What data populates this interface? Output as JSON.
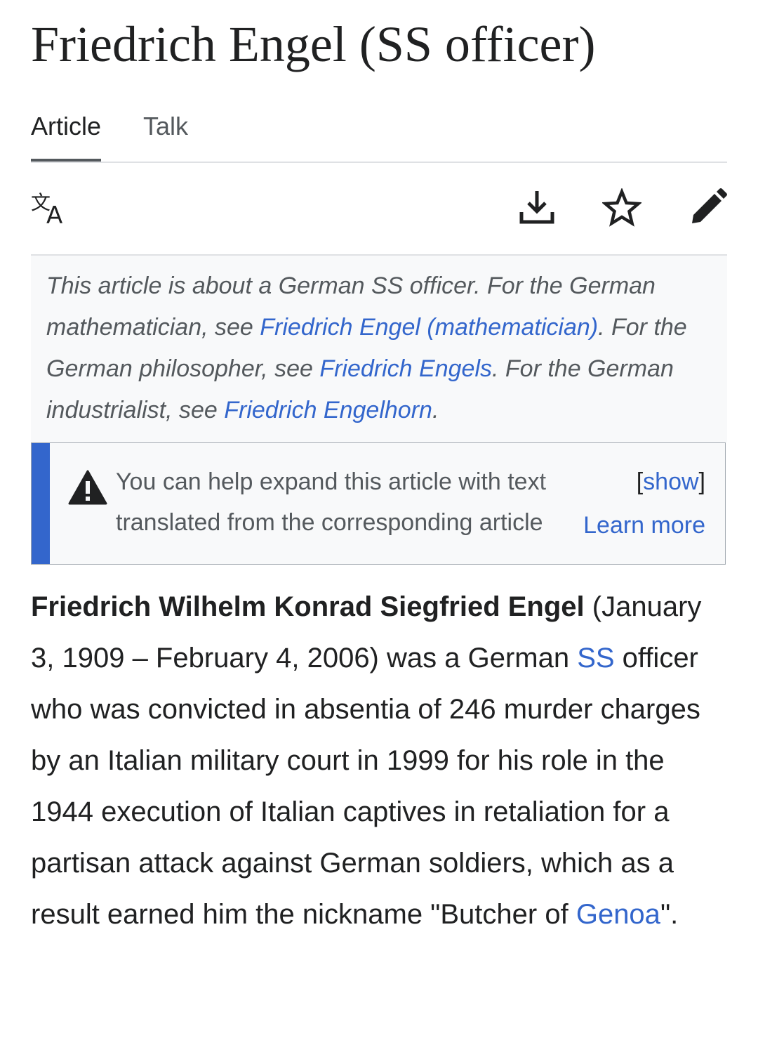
{
  "page": {
    "title": "Friedrich Engel (SS officer)"
  },
  "tabs": [
    {
      "label": "Article",
      "active": true
    },
    {
      "label": "Talk",
      "active": false
    }
  ],
  "toolbar": {
    "language_icon": "translate-icon",
    "download_icon": "download-icon",
    "watch_icon": "star-icon",
    "edit_icon": "pencil-icon"
  },
  "hatnote": {
    "t1": "This article is about a German SS officer. For the German mathematician, see ",
    "l1": "Friedrich Engel (mathematician)",
    "t2": ". For the German philosopher, see ",
    "l2": "Friedrich Engels",
    "t3": ". For the German industrialist, see ",
    "l3": "Friedrich Engelhorn",
    "t4": "."
  },
  "ambox": {
    "icon": "warning-icon",
    "line1": "You can help expand this article with text",
    "line2": "translated from the corresponding article",
    "show_open": "[",
    "show_link": "show",
    "show_close": "]",
    "learn_more": "Learn more"
  },
  "article": {
    "name": "Friedrich Wilhelm Konrad Siegfried Engel",
    "p1": " (January 3, 1909 – February 4, 2006) was a German ",
    "link_ss": "SS",
    "p2": " officer who was convicted in absentia of 246 murder charges by an Italian military court in 1999 for his role in the 1944 execution of Italian captives in retaliation for a partisan attack against German soldiers, which as a result earned him the nickname \"Butcher of ",
    "link_genoa": "Genoa",
    "p3": "\"."
  },
  "colors": {
    "text": "#202122",
    "link": "#3366cc",
    "muted": "#54595d",
    "divider": "#dfe1e4",
    "panel_bg": "#f8f9fa",
    "accent_bar": "#3366cc"
  }
}
